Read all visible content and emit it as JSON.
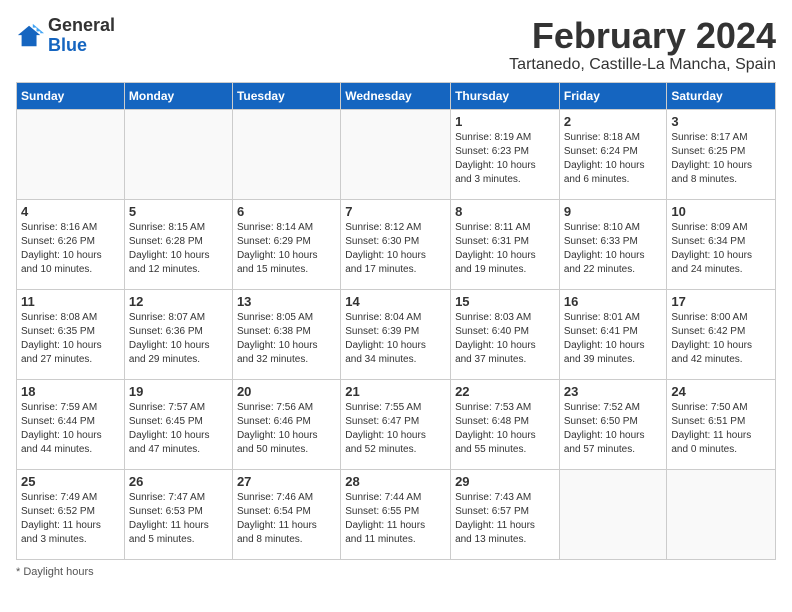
{
  "header": {
    "logo_general": "General",
    "logo_blue": "Blue",
    "month_title": "February 2024",
    "location": "Tartanedo, Castille-La Mancha, Spain"
  },
  "days_of_week": [
    "Sunday",
    "Monday",
    "Tuesday",
    "Wednesday",
    "Thursday",
    "Friday",
    "Saturday"
  ],
  "weeks": [
    [
      {
        "day": "",
        "info": ""
      },
      {
        "day": "",
        "info": ""
      },
      {
        "day": "",
        "info": ""
      },
      {
        "day": "",
        "info": ""
      },
      {
        "day": "1",
        "info": "Sunrise: 8:19 AM\nSunset: 6:23 PM\nDaylight: 10 hours\nand 3 minutes."
      },
      {
        "day": "2",
        "info": "Sunrise: 8:18 AM\nSunset: 6:24 PM\nDaylight: 10 hours\nand 6 minutes."
      },
      {
        "day": "3",
        "info": "Sunrise: 8:17 AM\nSunset: 6:25 PM\nDaylight: 10 hours\nand 8 minutes."
      }
    ],
    [
      {
        "day": "4",
        "info": "Sunrise: 8:16 AM\nSunset: 6:26 PM\nDaylight: 10 hours\nand 10 minutes."
      },
      {
        "day": "5",
        "info": "Sunrise: 8:15 AM\nSunset: 6:28 PM\nDaylight: 10 hours\nand 12 minutes."
      },
      {
        "day": "6",
        "info": "Sunrise: 8:14 AM\nSunset: 6:29 PM\nDaylight: 10 hours\nand 15 minutes."
      },
      {
        "day": "7",
        "info": "Sunrise: 8:12 AM\nSunset: 6:30 PM\nDaylight: 10 hours\nand 17 minutes."
      },
      {
        "day": "8",
        "info": "Sunrise: 8:11 AM\nSunset: 6:31 PM\nDaylight: 10 hours\nand 19 minutes."
      },
      {
        "day": "9",
        "info": "Sunrise: 8:10 AM\nSunset: 6:33 PM\nDaylight: 10 hours\nand 22 minutes."
      },
      {
        "day": "10",
        "info": "Sunrise: 8:09 AM\nSunset: 6:34 PM\nDaylight: 10 hours\nand 24 minutes."
      }
    ],
    [
      {
        "day": "11",
        "info": "Sunrise: 8:08 AM\nSunset: 6:35 PM\nDaylight: 10 hours\nand 27 minutes."
      },
      {
        "day": "12",
        "info": "Sunrise: 8:07 AM\nSunset: 6:36 PM\nDaylight: 10 hours\nand 29 minutes."
      },
      {
        "day": "13",
        "info": "Sunrise: 8:05 AM\nSunset: 6:38 PM\nDaylight: 10 hours\nand 32 minutes."
      },
      {
        "day": "14",
        "info": "Sunrise: 8:04 AM\nSunset: 6:39 PM\nDaylight: 10 hours\nand 34 minutes."
      },
      {
        "day": "15",
        "info": "Sunrise: 8:03 AM\nSunset: 6:40 PM\nDaylight: 10 hours\nand 37 minutes."
      },
      {
        "day": "16",
        "info": "Sunrise: 8:01 AM\nSunset: 6:41 PM\nDaylight: 10 hours\nand 39 minutes."
      },
      {
        "day": "17",
        "info": "Sunrise: 8:00 AM\nSunset: 6:42 PM\nDaylight: 10 hours\nand 42 minutes."
      }
    ],
    [
      {
        "day": "18",
        "info": "Sunrise: 7:59 AM\nSunset: 6:44 PM\nDaylight: 10 hours\nand 44 minutes."
      },
      {
        "day": "19",
        "info": "Sunrise: 7:57 AM\nSunset: 6:45 PM\nDaylight: 10 hours\nand 47 minutes."
      },
      {
        "day": "20",
        "info": "Sunrise: 7:56 AM\nSunset: 6:46 PM\nDaylight: 10 hours\nand 50 minutes."
      },
      {
        "day": "21",
        "info": "Sunrise: 7:55 AM\nSunset: 6:47 PM\nDaylight: 10 hours\nand 52 minutes."
      },
      {
        "day": "22",
        "info": "Sunrise: 7:53 AM\nSunset: 6:48 PM\nDaylight: 10 hours\nand 55 minutes."
      },
      {
        "day": "23",
        "info": "Sunrise: 7:52 AM\nSunset: 6:50 PM\nDaylight: 10 hours\nand 57 minutes."
      },
      {
        "day": "24",
        "info": "Sunrise: 7:50 AM\nSunset: 6:51 PM\nDaylight: 11 hours\nand 0 minutes."
      }
    ],
    [
      {
        "day": "25",
        "info": "Sunrise: 7:49 AM\nSunset: 6:52 PM\nDaylight: 11 hours\nand 3 minutes."
      },
      {
        "day": "26",
        "info": "Sunrise: 7:47 AM\nSunset: 6:53 PM\nDaylight: 11 hours\nand 5 minutes."
      },
      {
        "day": "27",
        "info": "Sunrise: 7:46 AM\nSunset: 6:54 PM\nDaylight: 11 hours\nand 8 minutes."
      },
      {
        "day": "28",
        "info": "Sunrise: 7:44 AM\nSunset: 6:55 PM\nDaylight: 11 hours\nand 11 minutes."
      },
      {
        "day": "29",
        "info": "Sunrise: 7:43 AM\nSunset: 6:57 PM\nDaylight: 11 hours\nand 13 minutes."
      },
      {
        "day": "",
        "info": ""
      },
      {
        "day": "",
        "info": ""
      }
    ]
  ],
  "footer": {
    "note": "Daylight hours"
  }
}
